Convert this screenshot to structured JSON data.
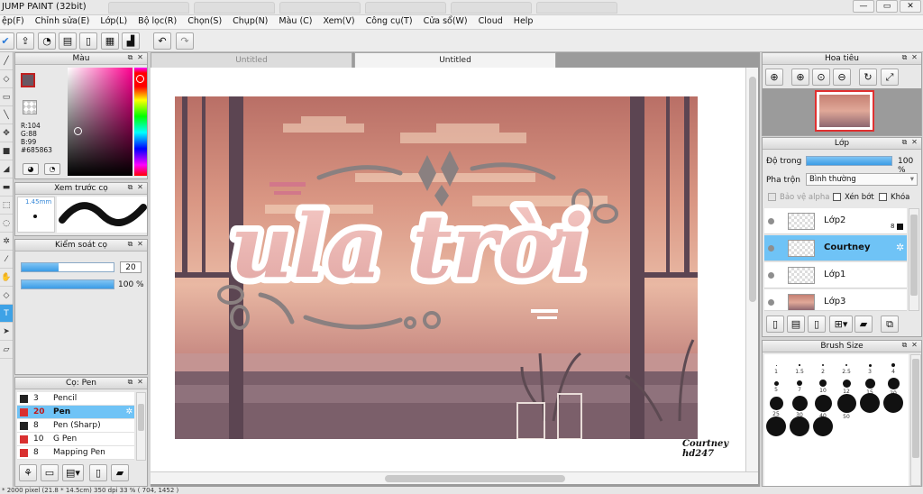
{
  "app": {
    "title": "JUMP PAINT (32bit)",
    "window_controls": [
      "—",
      "▭",
      "✕"
    ]
  },
  "menu": [
    "ệp(F)",
    "Chỉnh sửa(E)",
    "Lớp(L)",
    "Bộ lọc(R)",
    "Chọn(S)",
    "Chụp(N)",
    "Màu (C)",
    "Xem(V)",
    "Công cụ(T)",
    "Cửa sổ(W)",
    "Cloud",
    "Help"
  ],
  "color_panel": {
    "title": "Màu",
    "rgb": {
      "r": "R:104",
      "g": "G:88",
      "b": "B:99"
    },
    "hex": "#685863",
    "foreground": "#685863",
    "background": "#ffffff"
  },
  "brush_preview": {
    "title": "Xem trước cọ",
    "size": "1.45mm"
  },
  "brush_control": {
    "title": "Kiểm soát cọ",
    "size_value": "20",
    "opacity_value": "100 %",
    "size_fraction": 0.4,
    "opacity_fraction": 1.0
  },
  "brush_list": {
    "title": "Cọ: Pen",
    "items": [
      {
        "color": "#222222",
        "size": "3",
        "name": "Pencil",
        "selected": false
      },
      {
        "color": "#d93030",
        "size": "20",
        "name": "Pen",
        "selected": true
      },
      {
        "color": "#222222",
        "size": "8",
        "name": "Pen (Sharp)",
        "selected": false
      },
      {
        "color": "#d93030",
        "size": "10",
        "name": "G Pen",
        "selected": false
      },
      {
        "color": "#d93030",
        "size": "8",
        "name": "Mapping Pen",
        "selected": false
      }
    ]
  },
  "documents": {
    "tabs": [
      "Untitled",
      "Untitled"
    ],
    "active": 1
  },
  "artwork": {
    "title_text": "ula trời",
    "signature_line1": "Courtney",
    "signature_line2": "hd247"
  },
  "navigator": {
    "title": "Hoa tiêu"
  },
  "layers_panel": {
    "title": "Lớp",
    "opacity_label": "Độ trong",
    "opacity_value": "100 %",
    "opacity_fraction": 1.0,
    "blend_label": "Pha trộn",
    "blend_value": "Bình thường",
    "check_alpha": "Bảo vệ alpha",
    "check_clip": "Xén bớt",
    "check_lock": "Khóa",
    "layers": [
      {
        "name": "Lớp2",
        "badge": "8",
        "selected": false
      },
      {
        "name": "Courtney",
        "badge": "",
        "selected": true
      },
      {
        "name": "Lớp1",
        "badge": "",
        "selected": false
      },
      {
        "name": "Lớp3",
        "badge": "",
        "selected": false
      }
    ]
  },
  "brush_size_panel": {
    "title": "Brush Size",
    "sizes": [
      "1",
      "1.5",
      "2",
      "2.5",
      "3",
      "4",
      "5",
      "7",
      "10",
      "12",
      "15",
      "20",
      "25",
      "30",
      "40",
      "50",
      "",
      "",
      "",
      "",
      ""
    ]
  },
  "status": "* 2000 pixel  (21.8 * 14.5cm)  350 dpi  33 %  ( 704, 1452 )"
}
